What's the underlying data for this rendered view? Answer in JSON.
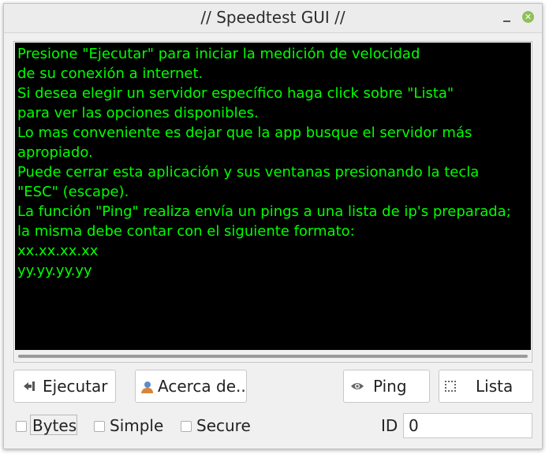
{
  "window": {
    "title": "// Speedtest GUI //"
  },
  "console": {
    "text_color": "#00ff00",
    "background": "#000000",
    "lines": [
      "Presione \"Ejecutar\" para iniciar la medición de velocidad",
      "de su conexión a internet.",
      "Si desea elegir un servidor específico haga click sobre \"Lista\"",
      "para ver las opciones disponibles.",
      "Lo mas conveniente es dejar que la app busque el servidor más",
      "apropiado.",
      "Puede cerrar esta aplicación y sus ventanas presionando la tecla",
      "\"ESC\" (escape).",
      "La función \"Ping\" realiza envía un pings a una lista de ip's preparada;",
      "la misma debe contar con el siguiente formato:",
      "xx.xx.xx.xx",
      "yy.yy.yy.yy"
    ]
  },
  "buttons": {
    "ejecutar": {
      "label": "Ejecutar",
      "icon": "exit-arrow-icon"
    },
    "acerca": {
      "label": "Acerca de..",
      "icon": "user-icon"
    },
    "ping": {
      "label": "Ping",
      "icon": "eye-icon"
    },
    "lista": {
      "label": "Lista",
      "icon": "list-icon"
    }
  },
  "options": {
    "bytes": {
      "label": "Bytes",
      "checked": false
    },
    "simple": {
      "label": "Simple",
      "checked": false
    },
    "secure": {
      "label": "Secure",
      "checked": false
    }
  },
  "id_field": {
    "label": "ID",
    "value": "0"
  },
  "colors": {
    "close_button": "#8fbf58"
  }
}
